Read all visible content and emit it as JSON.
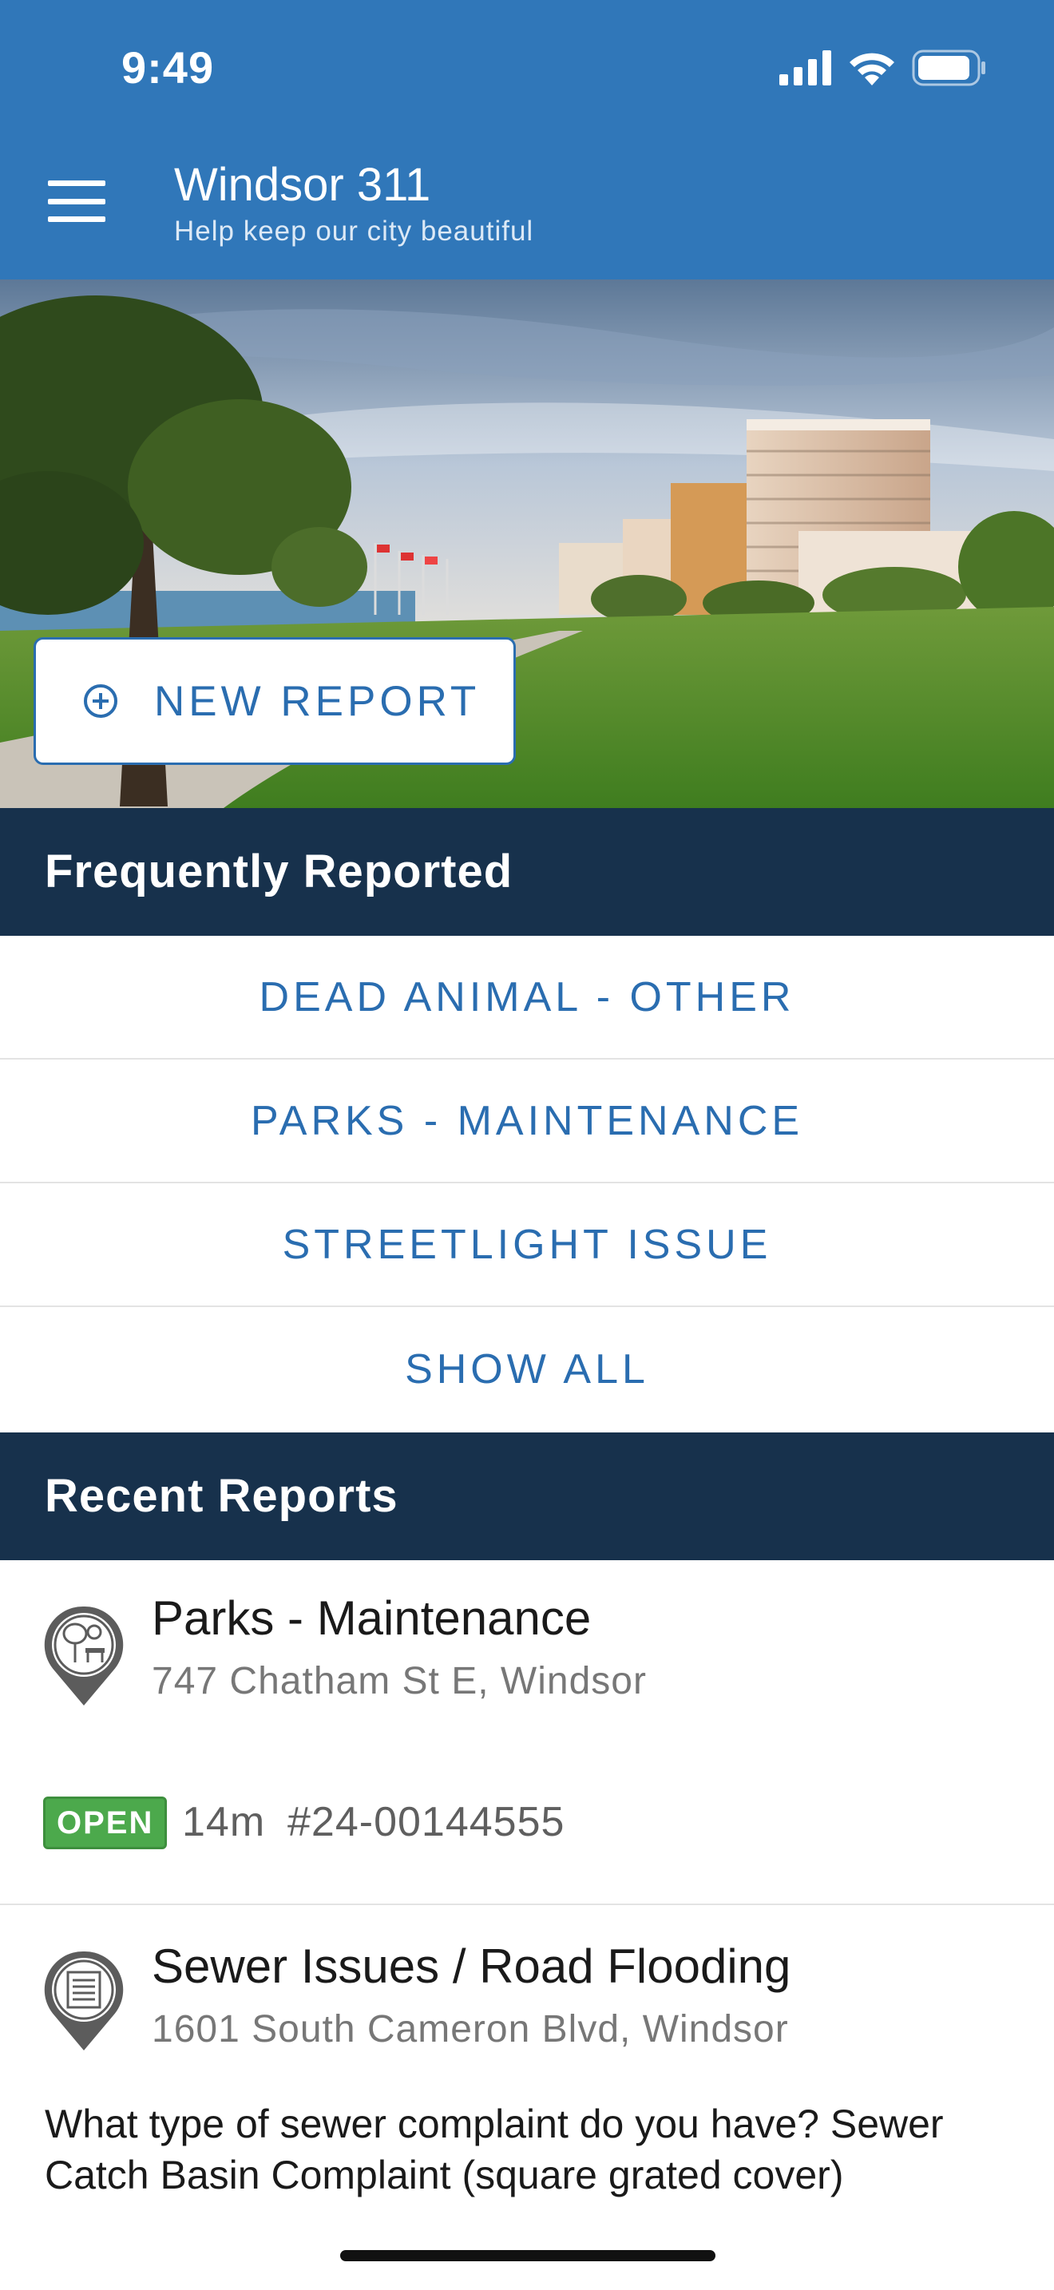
{
  "status_bar": {
    "time": "9:49"
  },
  "header": {
    "title": "Windsor 311",
    "subtitle": "Help keep our city beautiful"
  },
  "hero": {
    "new_report_label": "NEW REPORT"
  },
  "frequent": {
    "heading": "Frequently Reported",
    "items": [
      {
        "label": "DEAD ANIMAL - OTHER"
      },
      {
        "label": "PARKS - MAINTENANCE"
      },
      {
        "label": "STREETLIGHT ISSUE"
      },
      {
        "label": "SHOW ALL"
      }
    ]
  },
  "recent": {
    "heading": "Recent Reports",
    "reports": [
      {
        "title": "Parks - Maintenance",
        "address": "747 Chatham St E, Windsor",
        "status": "OPEN",
        "age": "14m",
        "number": "#24-00144555",
        "icon": "park-pin-icon"
      },
      {
        "title": "Sewer Issues / Road Flooding",
        "address": "1601 South Cameron Blvd, Windsor",
        "description": "What type of sewer complaint do you have? Sewer Catch Basin Complaint (square grated cover)",
        "icon": "document-pin-icon"
      }
    ]
  },
  "colors": {
    "appbar": "#3077b9",
    "section_header": "#17314c",
    "link": "#2a6db0",
    "status_open": "#4ca94c"
  }
}
